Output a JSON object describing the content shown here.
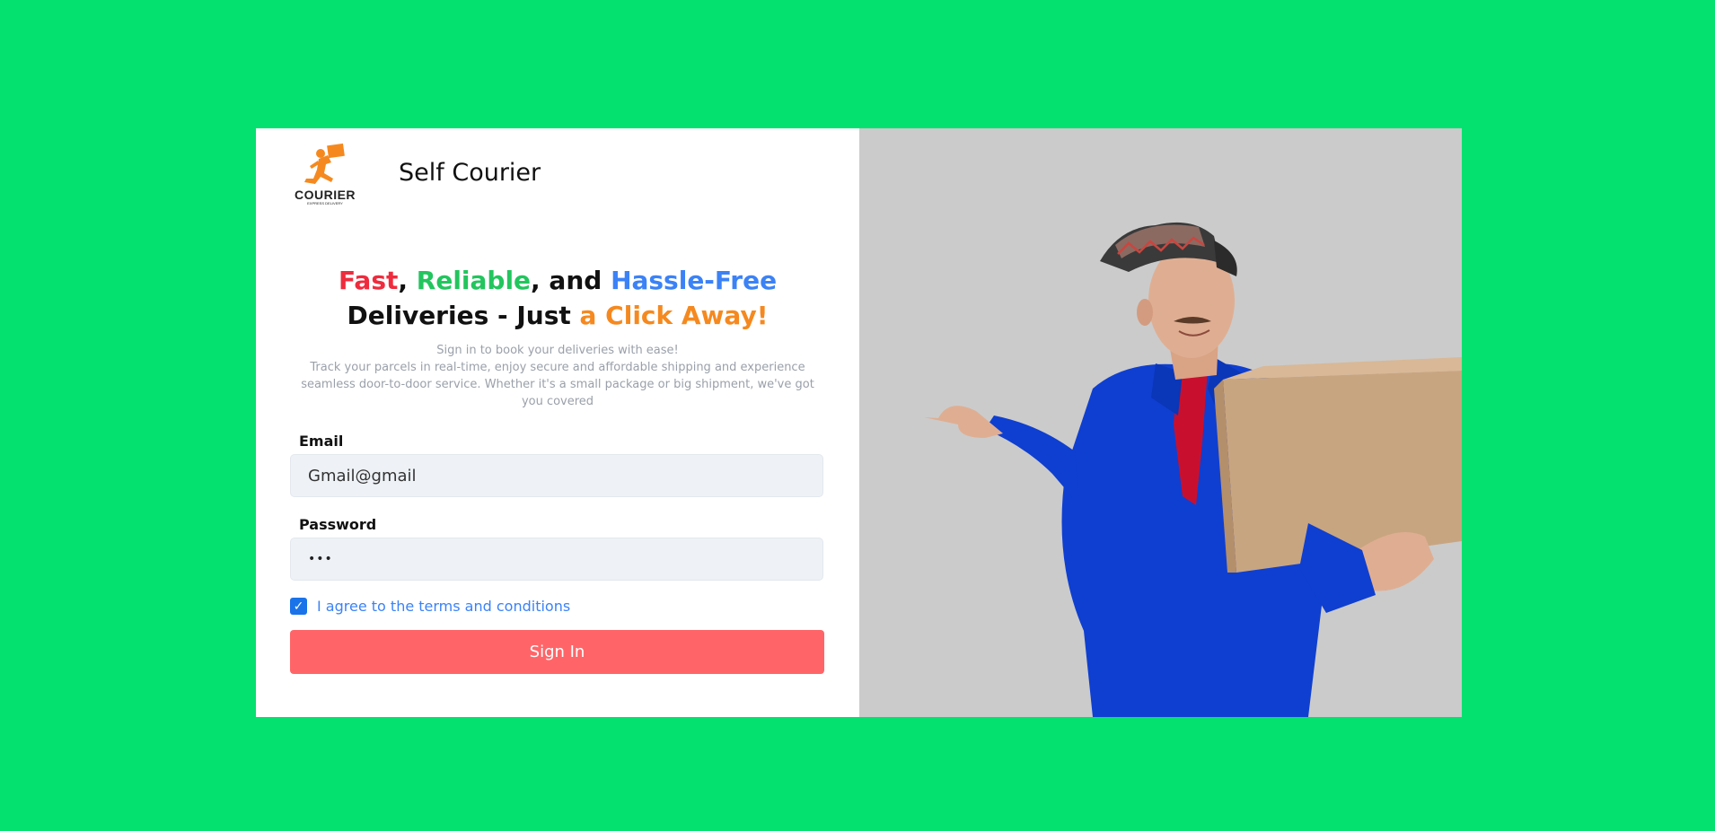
{
  "brand": {
    "logo_text": "COURIER",
    "logo_tagline": "EXPRESS DELIVERY",
    "logo_color": "#f5891f",
    "title": "Self Courier"
  },
  "headline": {
    "w1": "Fast",
    "w2": ",",
    "w3": "Reliable",
    "w4": ", and",
    "w5": "Hassle-Free",
    "w6": "Deliveries - Just",
    "w7": "a Click Away!"
  },
  "subtext": {
    "line1": "Sign in to book your deliveries with ease!",
    "line2": "Track your parcels in real-time, enjoy secure and affordable shipping and experience seamless door-to-door service. Whether it's a small package or big shipment, we've got you covered"
  },
  "form": {
    "email_label": "Email",
    "email_value": "Gmail@gmail",
    "password_label": "Password",
    "password_value": "•••",
    "terms_checked": true,
    "terms_label": "I agree to the terms and conditions",
    "signin_label": "Sign In"
  },
  "hero": {
    "description_icon": "courier-man-pointing-with-box-photo"
  },
  "colors": {
    "page_bg": "#04e16f",
    "accent_red": "#ef2b3d",
    "accent_green": "#22c55e",
    "accent_blue": "#3b82f6",
    "accent_orange": "#f5891f",
    "button": "#ff6568"
  }
}
